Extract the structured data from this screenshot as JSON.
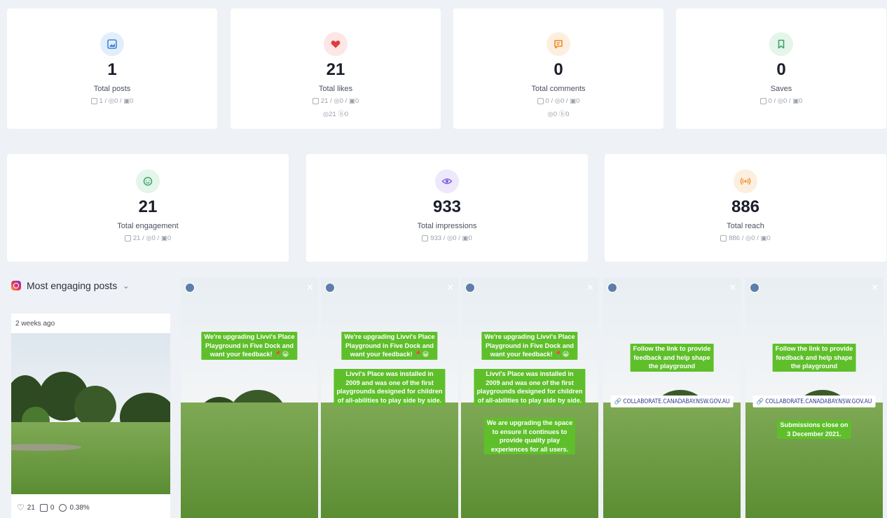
{
  "stats_row1": [
    {
      "id": "posts",
      "value": "1",
      "label": "Total posts",
      "breakdown": "1 / ◎0 / ▣0",
      "breakdown2": "",
      "icon": "image-icon",
      "color": "#3c86d8",
      "bg": "#e3eefc"
    },
    {
      "id": "likes",
      "value": "21",
      "label": "Total likes",
      "breakdown": "21 / ◎0 / ▣0",
      "breakdown2": "◎21 ⓑ0",
      "icon": "heart-icon",
      "color": "#e23b3b",
      "bg": "#fde6e6"
    },
    {
      "id": "comments",
      "value": "0",
      "label": "Total comments",
      "breakdown": "0 / ◎0 / ▣0",
      "breakdown2": "◎0 ⓑ0",
      "icon": "comment-icon",
      "color": "#f08a24",
      "bg": "#fdefe0"
    },
    {
      "id": "saves",
      "value": "0",
      "label": "Saves",
      "breakdown": "0 / ◎0 / ▣0",
      "breakdown2": "",
      "icon": "bookmark-icon",
      "color": "#3fa36a",
      "bg": "#e4f5ea"
    }
  ],
  "stats_row2": [
    {
      "id": "engagement",
      "value": "21",
      "label": "Total engagement",
      "breakdown": "21 / ◎0 / ▣0",
      "icon": "smile-icon",
      "color": "#3fa36a",
      "bg": "#e4f5ea"
    },
    {
      "id": "impressions",
      "value": "933",
      "label": "Total impressions",
      "breakdown": "933 / ◎0 / ▣0",
      "icon": "eye-icon",
      "color": "#7b5ce0",
      "bg": "#ede8fc"
    },
    {
      "id": "reach",
      "value": "886",
      "label": "Total reach",
      "breakdown": "886 / ◎0 / ▣0",
      "icon": "broadcast-icon",
      "color": "#f08a24",
      "bg": "#fdefe0"
    }
  ],
  "posts_section": {
    "title": "Most engaging posts",
    "chevron": "⌄",
    "post": {
      "time": "2 weeks ago",
      "likes": "21",
      "comments": "0",
      "engagement_rate": "0.38%"
    }
  },
  "stories": [
    {
      "captions": [
        "We're upgrading Livvi's Place",
        "Playground in Five Dock and",
        "want your feedback! 📍😀"
      ]
    },
    {
      "captions": [
        "We're upgrading Livvi's Place",
        "Playground in Five Dock and",
        "want your feedback! 📍😀"
      ],
      "captions2": [
        "Livvi's Place was installed in",
        "2009 and was one of the first",
        "playgrounds designed for children",
        "of all-abilities to play side by side."
      ]
    },
    {
      "captions": [
        "We're upgrading Livvi's Place",
        "Playground in Five Dock and",
        "want your feedback! 📍😀"
      ],
      "captions2": [
        "Livvi's Place was installed in",
        "2009 and was one of the first",
        "playgrounds designed for children",
        "of all-abilities to play side by side."
      ],
      "captions3": [
        "We are upgrading the space",
        "to ensure it continues to",
        "provide quality play",
        "experiences for all users."
      ]
    },
    {
      "captions": [
        "Follow the link to provide",
        "feedback and help shape",
        "the playground"
      ],
      "link": "🔗 COLLABORATE.CANADABAY.NSW.GOV.AU"
    },
    {
      "captions": [
        "Follow the link to provide",
        "feedback and help shape",
        "the playground"
      ],
      "link": "🔗 COLLABORATE.CANADABAY.NSW.GOV.AU",
      "captions3": [
        "Submissions close on",
        "3 December 2021."
      ]
    }
  ]
}
